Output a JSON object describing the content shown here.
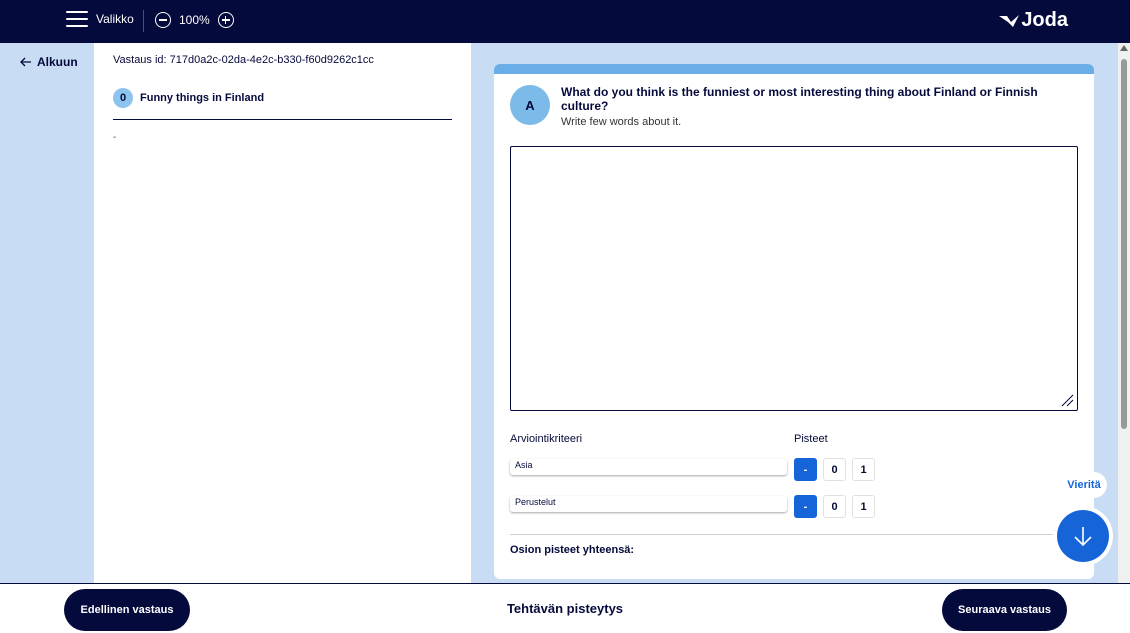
{
  "header": {
    "menu_label": "Valikko",
    "zoom_value": "100%",
    "logo_text": "Joda"
  },
  "sidebar": {
    "back_label": "Alkuun"
  },
  "left_panel": {
    "answer_id": "Vastaus id: 717d0a2c-02da-4e2c-b330-f60d9262c1cc",
    "section_number": "0",
    "section_title": "Funny things in Finland",
    "placeholder_dash": "-"
  },
  "question": {
    "avatar_letter": "A",
    "title": "What do you think is the funniest or most interesting thing about Finland or Finnish culture?",
    "subtitle": "Write few words about it.",
    "answer_text": ""
  },
  "scoring": {
    "criteria_header": "Arviointikriteeri",
    "points_header": "Pisteet",
    "criteria": [
      {
        "name": "Asia",
        "options": [
          "-",
          "0",
          "1"
        ],
        "selected": "-"
      },
      {
        "name": "Perustelut",
        "options": [
          "-",
          "0",
          "1"
        ],
        "selected": "-"
      }
    ],
    "total_label": "Osion pisteet yhteensä:"
  },
  "scroll_helper": {
    "label": "Vieritä"
  },
  "footer": {
    "prev_label": "Edellinen vastaus",
    "title": "Tehtävän pisteytys",
    "next_label": "Seuraava vastaus"
  },
  "colors": {
    "navy": "#050a3c",
    "light_blue": "#c8dcf4",
    "accent_blue": "#1565d8"
  }
}
